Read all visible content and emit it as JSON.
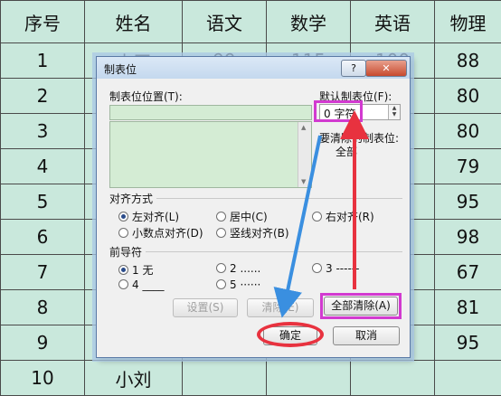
{
  "table": {
    "headers": [
      "序号",
      "姓名",
      "语文",
      "数学",
      "英语",
      "物理"
    ],
    "rows": [
      [
        "1",
        "小王",
        "99",
        "115",
        "100",
        "88"
      ],
      [
        "2",
        "",
        "",
        "",
        "",
        "80"
      ],
      [
        "3",
        "",
        "",
        "",
        "",
        "80"
      ],
      [
        "4",
        "",
        "",
        "",
        "",
        "79"
      ],
      [
        "5",
        "",
        "",
        "",
        "",
        "95"
      ],
      [
        "6",
        "",
        "",
        "",
        "",
        "98"
      ],
      [
        "7",
        "",
        "",
        "",
        "",
        "67"
      ],
      [
        "8",
        "",
        "",
        "",
        "",
        "81"
      ],
      [
        "9",
        "",
        "",
        "",
        "",
        "95"
      ],
      [
        "10",
        "小刘",
        "",
        "",
        "",
        ""
      ]
    ]
  },
  "dialog": {
    "title": "制表位",
    "help_label": "?",
    "close_label": "✕",
    "tab_position_label": "制表位位置(T):",
    "default_tab_label": "默认制表位(F):",
    "default_tab_value": "0 字符",
    "to_clear_label": "要清除的制表位:",
    "to_clear_value": "全部",
    "alignment": {
      "section_label": "对齐方式",
      "options": [
        "左对齐(L)",
        "居中(C)",
        "右对齐(R)",
        "小数点对齐(D)",
        "竖线对齐(B)"
      ],
      "selected": "左对齐(L)"
    },
    "leader": {
      "section_label": "前导符",
      "options": [
        "1 无",
        "2 ......",
        "3 ------",
        "4 ____",
        "5 ······"
      ],
      "selected": "1 无"
    },
    "set_button": "设置(S)",
    "clear_button": "清除(E)",
    "clear_all_button": "全部清除(A)",
    "ok_button": "确定",
    "cancel_button": "取消"
  },
  "annotations": {
    "highlight_color": "#d23ad0",
    "arrow_blue": "#3a8fe0",
    "arrow_red": "#e8323f"
  }
}
